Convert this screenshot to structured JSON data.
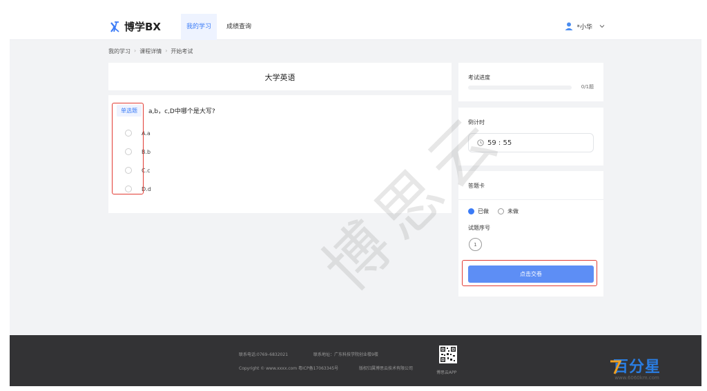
{
  "header": {
    "brand": "博学BX",
    "nav": [
      {
        "label": "我的学习",
        "active": true
      },
      {
        "label": "成绩查询",
        "active": false
      }
    ],
    "user_name": "*小华"
  },
  "breadcrumb": [
    "我的学习",
    "课程详情",
    "开始考试"
  ],
  "breadcrumb_separator": "›",
  "exam": {
    "title": "大学英语",
    "question": {
      "type_tag": "单选题",
      "text": "a,b，c,D中哪个是大写?",
      "options": [
        "A.a",
        "B.b",
        "C.c",
        "D.d"
      ]
    }
  },
  "progress": {
    "label": "考试进度",
    "count_text": "0/1题",
    "fraction": 0.0
  },
  "timer": {
    "label": "倒计时",
    "value": "59 : 55"
  },
  "answer_card": {
    "label": "答题卡",
    "legend_done": "已做",
    "legend_todo": "未做",
    "qnum_label": "试题序号",
    "numbers": [
      "1"
    ],
    "submit_label": "点击交卷"
  },
  "watermark": "博思云",
  "footer": {
    "phone": "联系电话:0769–6832021",
    "address": "联系地址：广东科技学院创业楼9楼",
    "copyright": "Copyright © www.xxxx.com 粤ICP备17063345号",
    "rights": "版权归属博思云技术有限公司",
    "qr_label": "博思云APP"
  },
  "corner_brand": {
    "main": "百分星",
    "sub": "www.6060km.com"
  },
  "colors": {
    "accent": "#3a7bf7",
    "submit": "#5d8ef5",
    "highlight_box": "#e23a32",
    "footer_bg": "#333335"
  }
}
